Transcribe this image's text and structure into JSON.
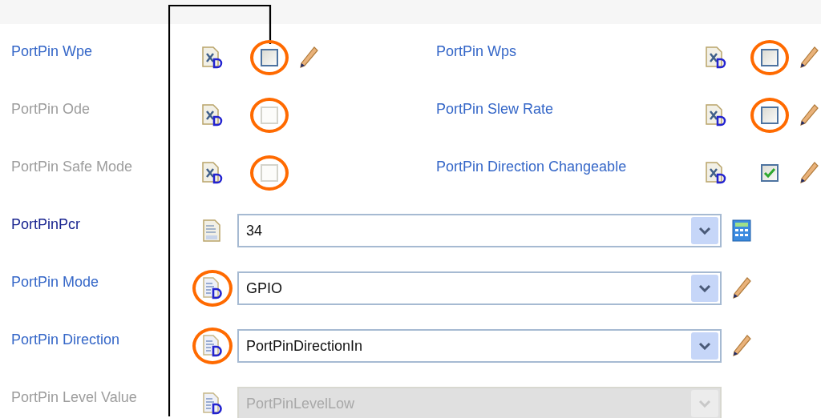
{
  "rows": [
    {
      "settings": [
        {
          "label": "PortPin Wpe",
          "disabled": false,
          "required": false,
          "kind": "checkbox",
          "checked": false,
          "editable": true,
          "highlight_control": true,
          "highlight_icon": false
        },
        {
          "label": "PortPin Wps",
          "disabled": false,
          "required": false,
          "kind": "checkbox",
          "checked": false,
          "editable": true,
          "highlight_control": true,
          "highlight_icon": false
        }
      ]
    },
    {
      "settings": [
        {
          "label": "PortPin Ode",
          "disabled": true,
          "required": false,
          "kind": "checkbox",
          "checked": false,
          "editable": false,
          "highlight_control": true,
          "highlight_icon": false
        },
        {
          "label": "PortPin Slew Rate",
          "disabled": false,
          "required": false,
          "kind": "checkbox",
          "checked": false,
          "editable": true,
          "highlight_control": true,
          "highlight_icon": false
        }
      ]
    },
    {
      "settings": [
        {
          "label": "PortPin Safe Mode",
          "disabled": true,
          "required": false,
          "kind": "checkbox",
          "checked": false,
          "editable": false,
          "highlight_control": true,
          "highlight_icon": false
        },
        {
          "label": "PortPin Direction Changeable",
          "disabled": false,
          "required": false,
          "kind": "checkbox",
          "checked": true,
          "editable": true,
          "highlight_control": false,
          "highlight_icon": false
        }
      ]
    },
    {
      "settings": [
        {
          "label": "PortPinPcr",
          "disabled": false,
          "required": true,
          "kind": "number",
          "value": "34",
          "highlight_control": false,
          "highlight_icon": false
        }
      ]
    },
    {
      "settings": [
        {
          "label": "PortPin Mode",
          "disabled": false,
          "required": false,
          "kind": "choice",
          "value": "GPIO",
          "editable": true,
          "highlight_control": false,
          "highlight_icon": true
        }
      ]
    },
    {
      "settings": [
        {
          "label": "PortPin Direction",
          "disabled": false,
          "required": false,
          "kind": "choice",
          "value": "PortPinDirectionIn",
          "editable": true,
          "highlight_control": false,
          "highlight_icon": true
        }
      ]
    },
    {
      "settings": [
        {
          "label": "PortPin Level Value",
          "disabled": true,
          "required": false,
          "kind": "choice",
          "value": "PortPinLevelLow",
          "editable": false,
          "highlight_control": false,
          "highlight_icon": false
        }
      ]
    }
  ]
}
